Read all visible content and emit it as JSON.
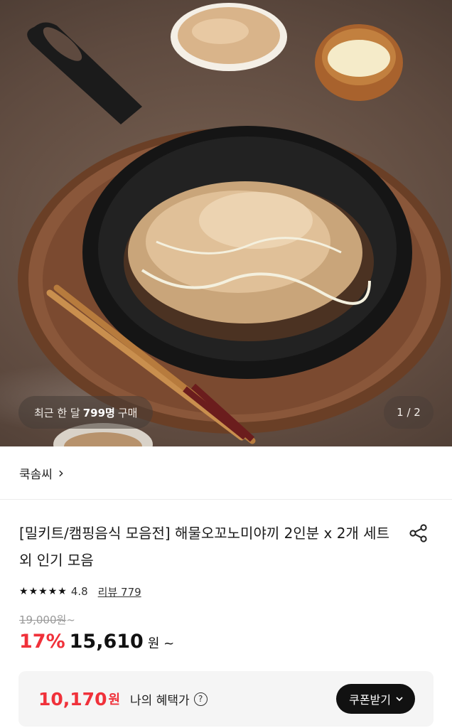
{
  "hero": {
    "buyers_prefix": "최근 한 달",
    "buyers_count": "799명",
    "buyers_suffix": "구매",
    "page_indicator": "1 / 2"
  },
  "seller": {
    "name": "쿡솜씨",
    "chevron": "›"
  },
  "product": {
    "title": "[밀키트/캠핑음식 모음전] 해물오꼬노미야끼 2인분 x 2개 세트 외 인기 모음",
    "share_icon": "share-icon"
  },
  "rating": {
    "stars": 5,
    "score": "4.8",
    "review_label": "리뷰 779"
  },
  "price": {
    "original": "19,000원",
    "original_suffix": "~",
    "discount": "17%",
    "sale": "15,610",
    "won": "원",
    "suffix": "~"
  },
  "benefit": {
    "price": "10,170",
    "won": "원",
    "label": "나의 혜택가",
    "help": "?",
    "coupon_button": "쿠폰받기"
  },
  "colors": {
    "accent_red": "#f0313a",
    "button_black": "#111111"
  }
}
